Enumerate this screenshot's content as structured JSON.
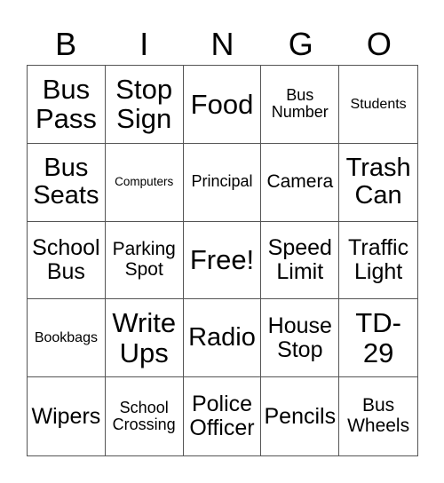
{
  "header": {
    "letters": [
      "B",
      "I",
      "N",
      "G",
      "O"
    ]
  },
  "cells": [
    {
      "text": "Bus Pass",
      "size": "s-xl"
    },
    {
      "text": "Stop Sign",
      "size": "s-xl"
    },
    {
      "text": "Food",
      "size": "s-xl"
    },
    {
      "text": "Bus Number",
      "size": "s-xs"
    },
    {
      "text": "Students",
      "size": "s-xxs"
    },
    {
      "text": "Bus Seats",
      "size": "s-l"
    },
    {
      "text": "Computers",
      "size": "s-tiny"
    },
    {
      "text": "Principal",
      "size": "s-xs"
    },
    {
      "text": "Camera",
      "size": "s-s"
    },
    {
      "text": "Trash Can",
      "size": "s-l"
    },
    {
      "text": "School Bus",
      "size": "s-m"
    },
    {
      "text": "Parking Spot",
      "size": "s-s"
    },
    {
      "text": "Free!",
      "size": "s-xl"
    },
    {
      "text": "Speed Limit",
      "size": "s-m"
    },
    {
      "text": "Traffic Light",
      "size": "s-m"
    },
    {
      "text": "Bookbags",
      "size": "s-xxs"
    },
    {
      "text": "Write Ups",
      "size": "s-xl"
    },
    {
      "text": "Radio",
      "size": "s-l"
    },
    {
      "text": "House Stop",
      "size": "s-m"
    },
    {
      "text": "TD-29",
      "size": "s-xl"
    },
    {
      "text": "Wipers",
      "size": "s-m"
    },
    {
      "text": "School Crossing",
      "size": "s-xs"
    },
    {
      "text": "Police Officer",
      "size": "s-m"
    },
    {
      "text": "Pencils",
      "size": "s-m"
    },
    {
      "text": "Bus Wheels",
      "size": "s-s"
    }
  ]
}
